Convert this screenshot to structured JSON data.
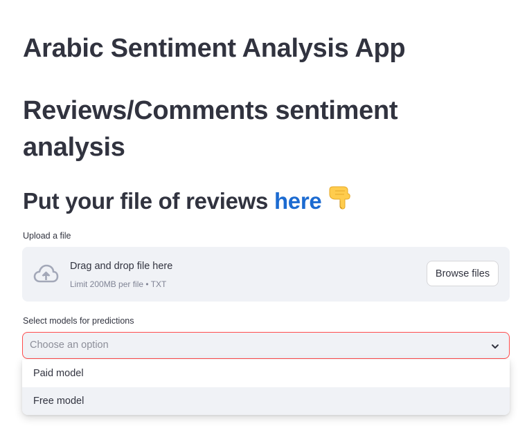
{
  "titles": {
    "app_title": "Arabic Sentiment Analysis App",
    "subtitle": "Reviews/Comments sentiment analysis",
    "prompt_prefix": "Put your file of reviews ",
    "prompt_link": "here",
    "prompt_emoji": "👇"
  },
  "uploader": {
    "label": "Upload a file",
    "drag_text": "Drag and drop file here",
    "limit_text": "Limit 200MB per file • TXT",
    "browse_button": "Browse files",
    "icon": "cloud-upload-icon"
  },
  "models_select": {
    "label": "Select models for predictions",
    "placeholder": "Choose an option",
    "options": [
      "Paid model",
      "Free model"
    ],
    "highlighted_option": "Free model",
    "icon": "chevron-down-icon"
  },
  "colors": {
    "text": "#31333f",
    "link": "#1c6bd1",
    "accent_border": "#ff4b4b",
    "panel_bg": "#f0f2f6"
  }
}
